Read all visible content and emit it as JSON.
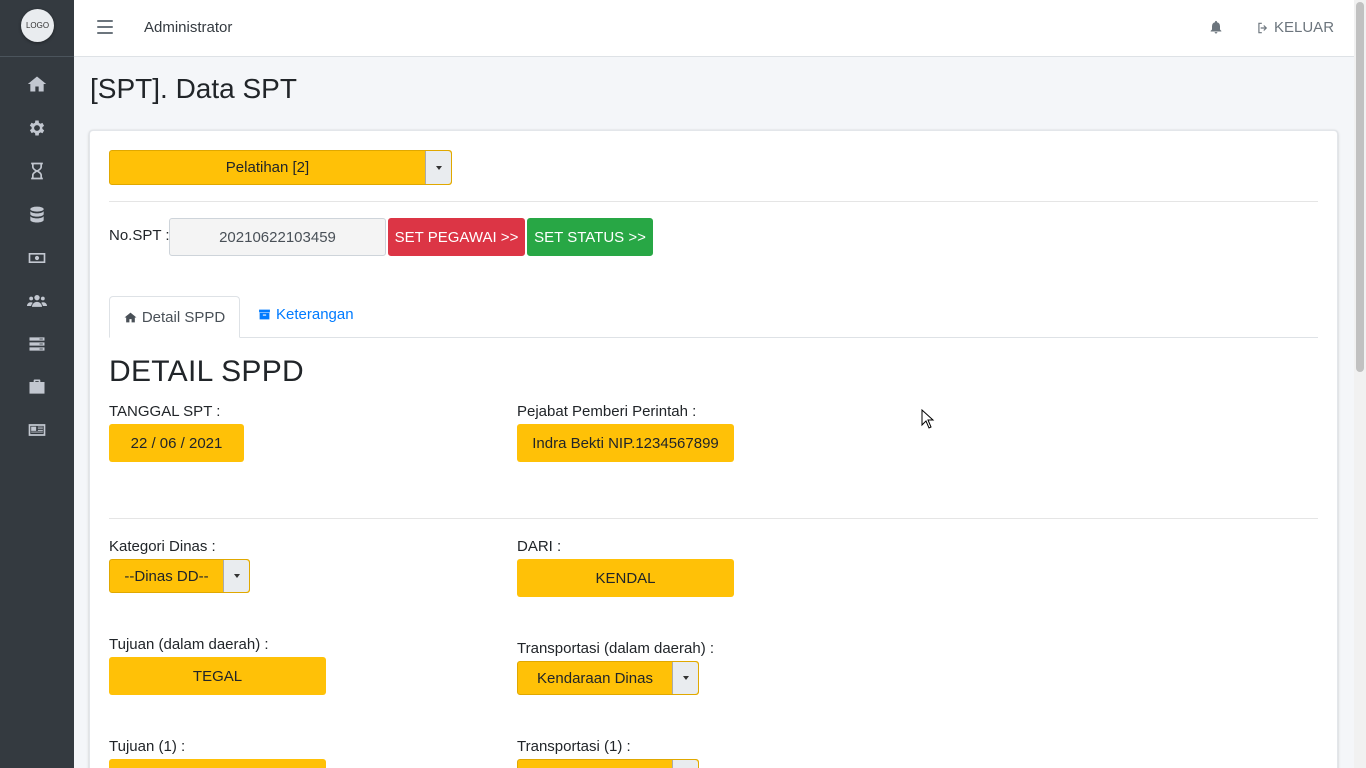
{
  "sidebar": {
    "logo_text": "LOGO",
    "items": [
      {
        "icon": "home-icon"
      },
      {
        "icon": "gear-icon"
      },
      {
        "icon": "hourglass-icon"
      },
      {
        "icon": "database-icon"
      },
      {
        "icon": "money-icon"
      },
      {
        "icon": "users-icon"
      },
      {
        "icon": "server-icon"
      },
      {
        "icon": "briefcase-icon"
      },
      {
        "icon": "newspaper-icon"
      }
    ]
  },
  "navbar": {
    "title": "Administrator",
    "logout_label": "KELUAR"
  },
  "page": {
    "title": "[SPT]. Data SPT"
  },
  "form": {
    "kategori_select": "Pelatihan [2]",
    "no_spt_label": "No.SPT :",
    "no_spt_value": "20210622103459",
    "set_pegawai_label": "SET PEGAWAI >>",
    "set_status_label": "SET STATUS >>"
  },
  "tabs": [
    {
      "label": "Detail SPPD",
      "icon": "home-icon",
      "active": true
    },
    {
      "label": "Keterangan",
      "icon": "archive-icon",
      "active": false
    }
  ],
  "detail": {
    "section_title": "DETAIL SPPD",
    "tanggal_label": "TANGGAL SPT :",
    "tanggal_value": "22 / 06 / 2021",
    "pejabat_label": "Pejabat Pemberi Perintah :",
    "pejabat_value": "Indra Bekti NIP.1234567899",
    "kategori_dinas_label": "Kategori Dinas :",
    "kategori_dinas_value": "--Dinas DD--",
    "dari_label": "DARI :",
    "dari_value": "KENDAL",
    "tujuan_dalam_label": "Tujuan (dalam daerah) :",
    "tujuan_dalam_value": "TEGAL",
    "transportasi_dalam_label": "Transportasi (dalam daerah) :",
    "transportasi_dalam_value": "Kendaraan Dinas",
    "tujuan1_label": "Tujuan (1) :",
    "transportasi1_label": "Transportasi (1) :"
  },
  "colors": {
    "accent_yellow": "#ffc107",
    "danger": "#dc3545",
    "success": "#28a745",
    "sidebar_bg": "#343a40",
    "link": "#007bff"
  }
}
